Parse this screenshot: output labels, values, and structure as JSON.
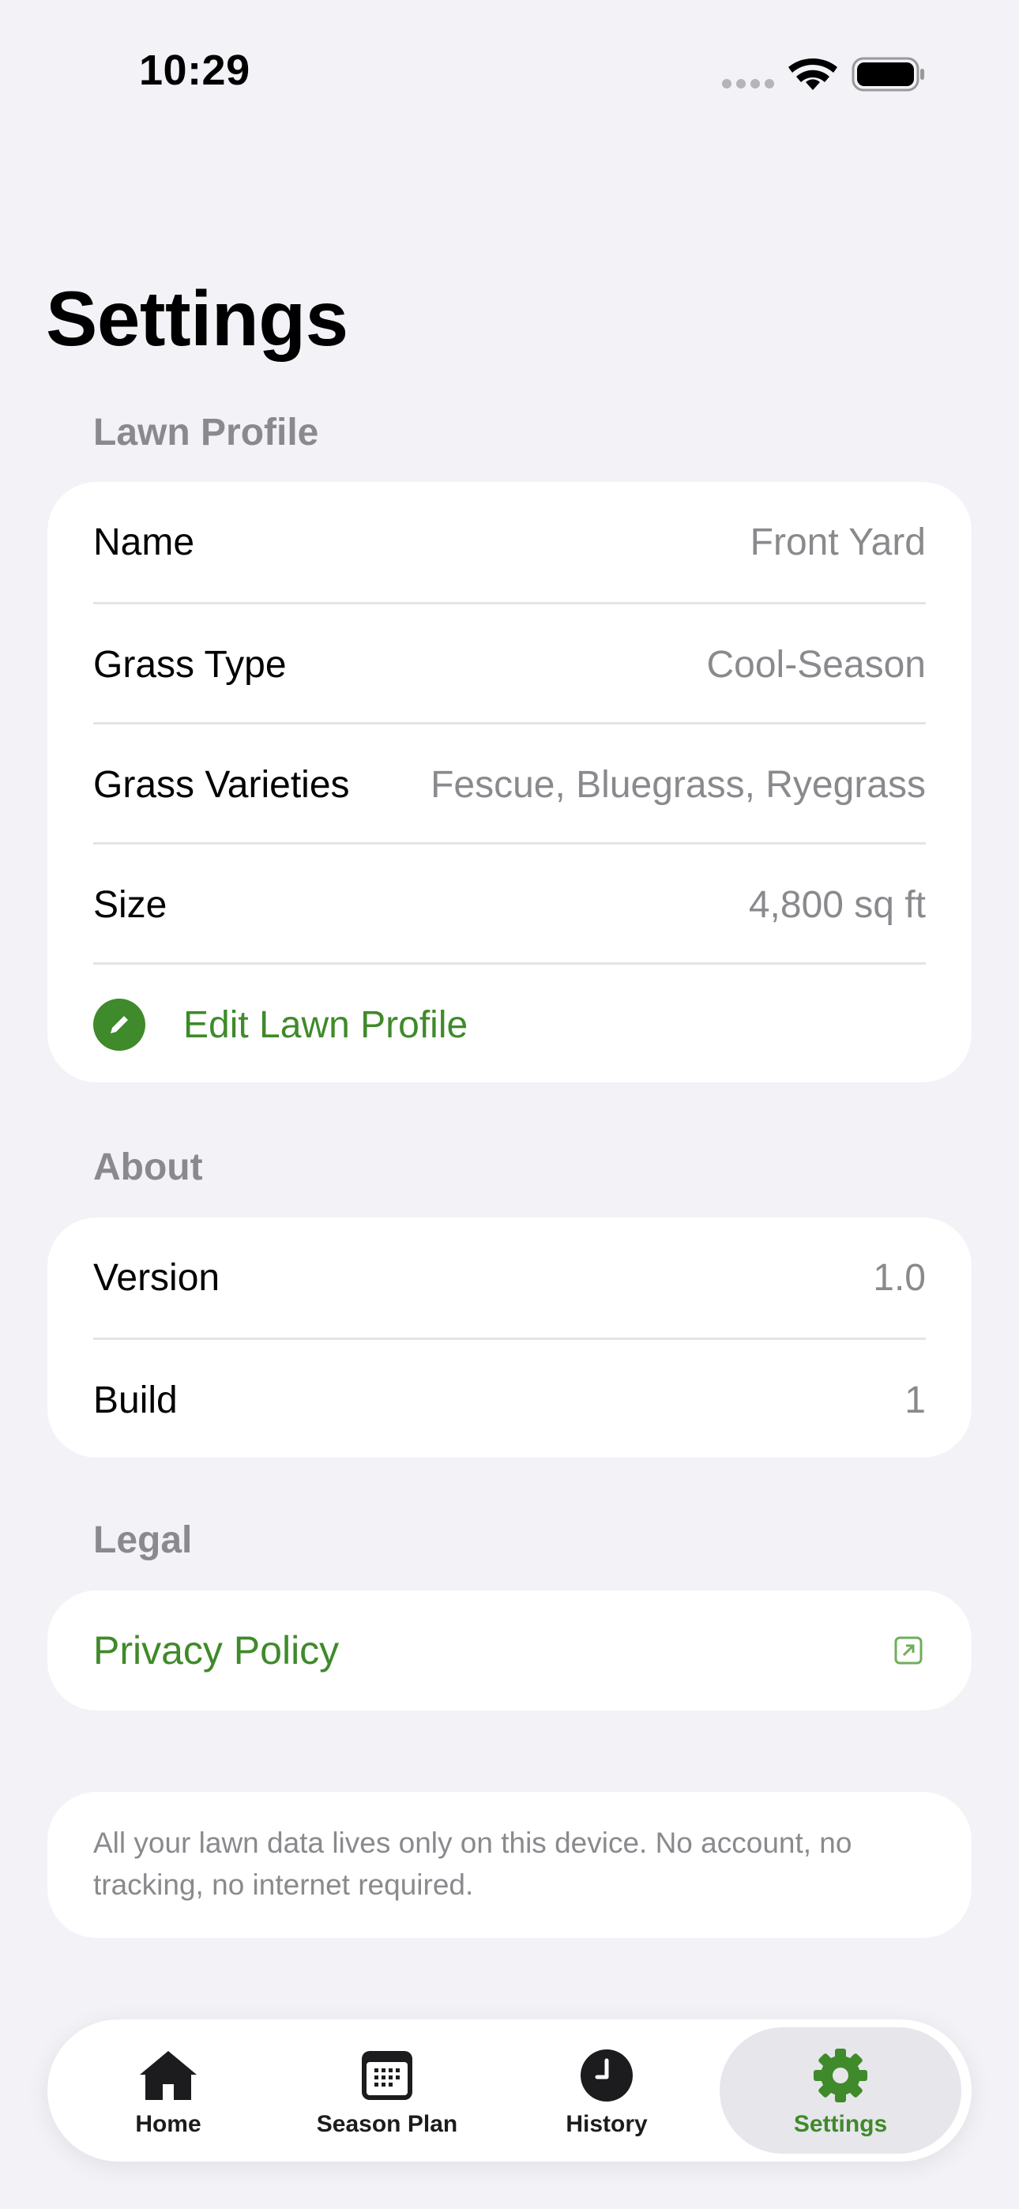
{
  "status_bar": {
    "time": "10:29"
  },
  "page": {
    "title": "Settings"
  },
  "lawn_profile": {
    "header": "Lawn Profile",
    "rows": [
      {
        "label": "Name",
        "value": "Front Yard"
      },
      {
        "label": "Grass Type",
        "value": "Cool-Season"
      },
      {
        "label": "Grass Varieties",
        "value": "Fescue, Bluegrass, Ryegrass"
      },
      {
        "label": "Size",
        "value": "4,800 sq ft"
      }
    ],
    "edit_label": "Edit Lawn Profile"
  },
  "about": {
    "header": "About",
    "rows": [
      {
        "label": "Version",
        "value": "1.0"
      },
      {
        "label": "Build",
        "value": "1"
      }
    ]
  },
  "legal": {
    "header": "Legal",
    "privacy_label": "Privacy Policy"
  },
  "info": {
    "text": "All your lawn data lives only on this device. No account, no tracking, no internet required."
  },
  "tab_bar": {
    "active": "Settings",
    "tabs": [
      {
        "label": "Home",
        "icon": "house-icon"
      },
      {
        "label": "Season Plan",
        "icon": "calendar-icon"
      },
      {
        "label": "History",
        "icon": "clock-icon"
      },
      {
        "label": "Settings",
        "icon": "gear-icon"
      }
    ]
  },
  "colors": {
    "accent": "#3f8a2a",
    "background": "#f2f2f7",
    "secondary_text": "#8a8a8e"
  }
}
